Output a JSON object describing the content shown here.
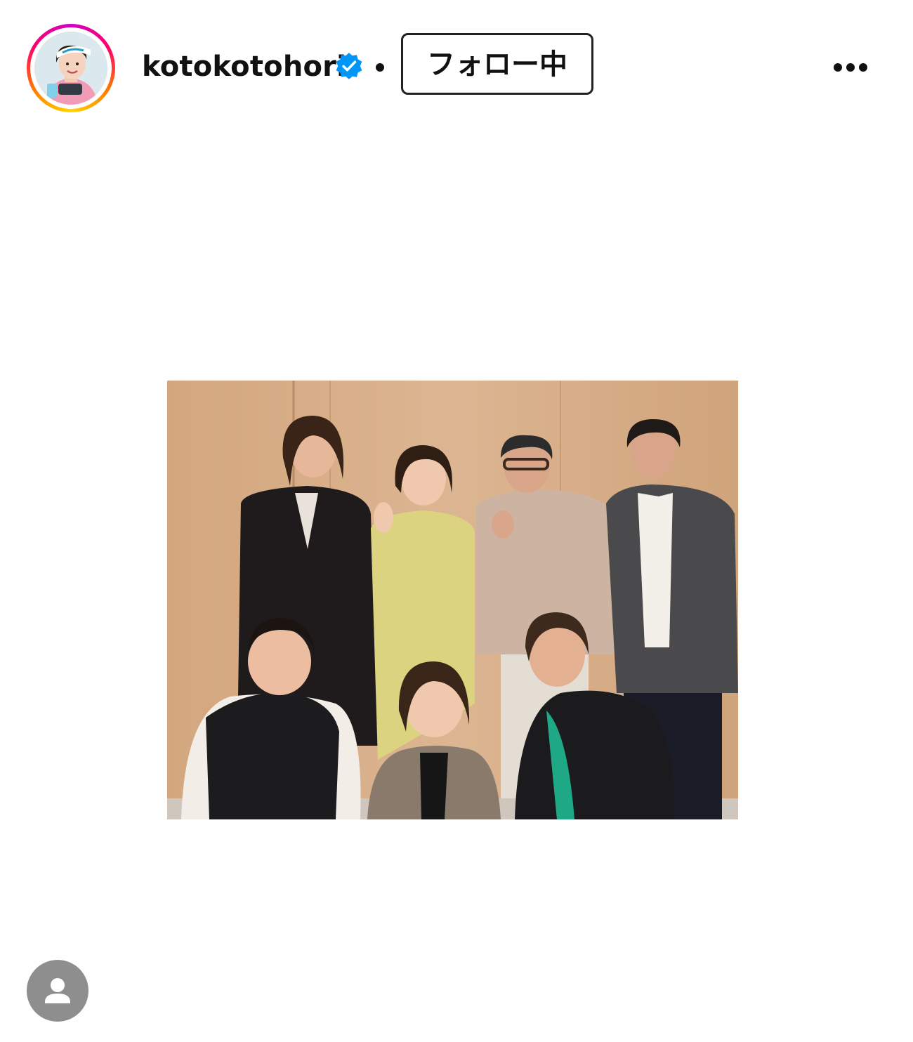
{
  "post": {
    "username": "kotokotohori",
    "verified": true,
    "follow_label": "フォロー中",
    "more_icon": "more-horizontal-icon",
    "user_tag_icon": "user-tag-icon"
  },
  "colors": {
    "verified_blue": "#0095f6",
    "story_ring": [
      "#d300c5",
      "#ff0069",
      "#ff7a00",
      "#ffd600"
    ],
    "tag_gray": "#8e8e8e"
  }
}
